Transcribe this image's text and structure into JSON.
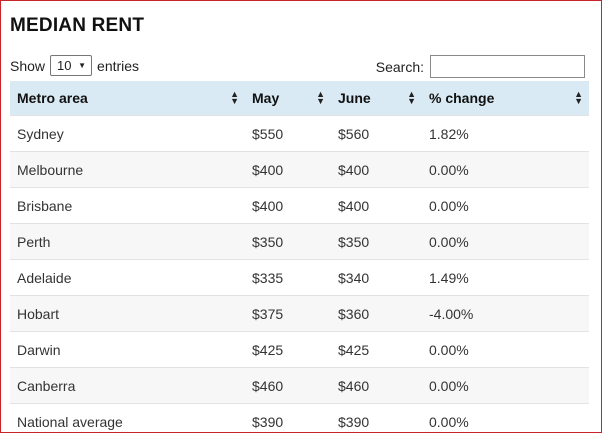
{
  "title": "MEDIAN RENT",
  "length_control": {
    "prefix": "Show",
    "selected": "10",
    "suffix": "entries"
  },
  "search": {
    "label": "Search:",
    "value": ""
  },
  "table": {
    "headers": [
      "Metro area",
      "May",
      "June",
      "% change"
    ],
    "rows": [
      [
        "Sydney",
        "$550",
        "$560",
        "1.82%"
      ],
      [
        "Melbourne",
        "$400",
        "$400",
        "0.00%"
      ],
      [
        "Brisbane",
        "$400",
        "$400",
        "0.00%"
      ],
      [
        "Perth",
        "$350",
        "$350",
        "0.00%"
      ],
      [
        "Adelaide",
        "$335",
        "$340",
        "1.49%"
      ],
      [
        "Hobart",
        "$375",
        "$360",
        "-4.00%"
      ],
      [
        "Darwin",
        "$425",
        "$425",
        "0.00%"
      ],
      [
        "Canberra",
        "$460",
        "$460",
        "0.00%"
      ],
      [
        "National average",
        "$390",
        "$390",
        "0.00%"
      ]
    ]
  },
  "colors": {
    "header_bg": "#d9eaf4",
    "frame_border": "#c8242b",
    "zebra_row": "#f7f7f7"
  }
}
